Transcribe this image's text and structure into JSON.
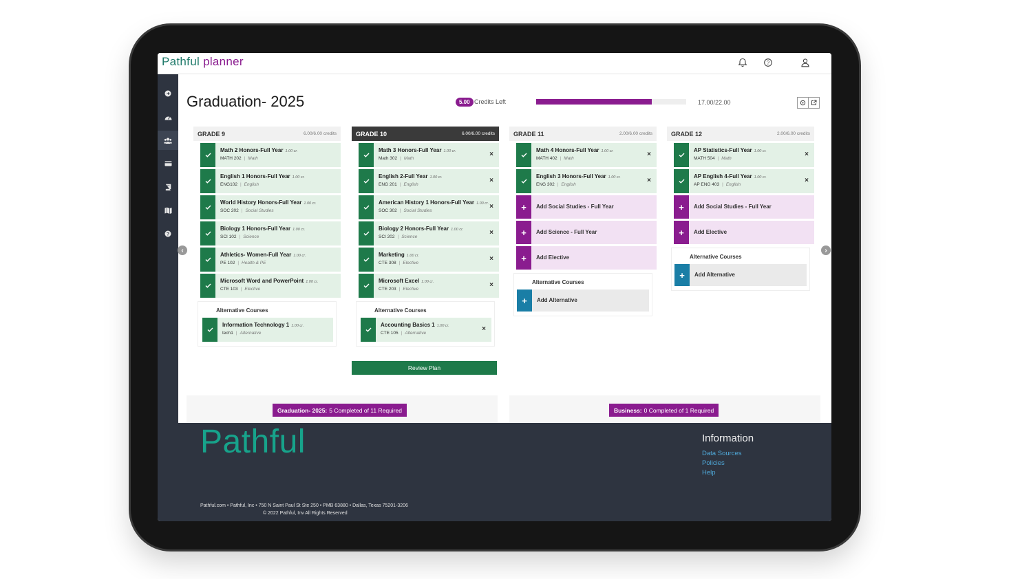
{
  "header": {
    "logo_part1": "Pathful",
    "logo_part2": "planner",
    "icons": [
      "bell-icon",
      "help-icon",
      "user-icon"
    ]
  },
  "sidebar": {
    "items": [
      "arrow-right-icon",
      "dashboard-icon",
      "users-icon",
      "card-icon",
      "book-icon",
      "map-icon",
      "help-icon"
    ],
    "active_index": 2
  },
  "plan": {
    "title": "Graduation- 2025",
    "credits_left_value": "5.00",
    "credits_left_label": "Credits Left",
    "progress_fraction": 0.7727,
    "progress_text": "17.00/22.00"
  },
  "columns": [
    {
      "grade": "GRADE 9",
      "credits": "6.00/6.00 credits",
      "courses": [
        {
          "name": "Math 2 Honors-Full Year",
          "cr": "1.00 cr.",
          "code": "MATH 202",
          "subject": "Math"
        },
        {
          "name": "English 1 Honors-Full Year",
          "cr": "1.00 cr.",
          "code": "ENG102",
          "subject": "English"
        },
        {
          "name": "World History Honors-Full Year",
          "cr": "1.00 cr.",
          "code": "SOC 202",
          "subject": "Social Studies"
        },
        {
          "name": "Biology 1 Honors-Full Year",
          "cr": "1.00 cr.",
          "code": "SCI 102",
          "subject": "Science"
        },
        {
          "name": "Athletics- Women-Full Year",
          "cr": "1.00 cr.",
          "code": "PE 102",
          "subject": "Health & PE"
        },
        {
          "name": "Microsoft Word and PowerPoint",
          "cr": "1.00 cr.",
          "code": "CTE 103",
          "subject": "Elective"
        }
      ],
      "adds": [],
      "alt_title": "Alternative Courses",
      "alt_course": {
        "name": "Information Technology 1",
        "cr": "1.00 cr.",
        "code": "tech1",
        "subject": "Alternative"
      }
    },
    {
      "grade": "GRADE 10",
      "credits": "6.00/6.00 credits",
      "courses": [
        {
          "name": "Math 3 Honors-Full Year",
          "cr": "1.00 cr.",
          "code": "Math 302",
          "subject": "Math"
        },
        {
          "name": "English 2-Full Year",
          "cr": "1.00 cr.",
          "code": "ENG 201",
          "subject": "English"
        },
        {
          "name": "American History 1 Honors-Full Year",
          "cr": "1.00 cr.",
          "code": "SOC 302",
          "subject": "Social Studies"
        },
        {
          "name": "Biology 2 Honors-Full Year",
          "cr": "1.00 cr.",
          "code": "SCI 202",
          "subject": "Science"
        },
        {
          "name": "Marketing",
          "cr": "1.00 cr.",
          "code": "CTE 308",
          "subject": "Elective"
        },
        {
          "name": "Microsoft Excel",
          "cr": "1.00 cr.",
          "code": "CTE 203",
          "subject": "Elective"
        }
      ],
      "adds": [],
      "alt_title": "Alternative Courses",
      "alt_course": {
        "name": "Accounting Basics 1",
        "cr": "1.00 cr.",
        "code": "CTE 105",
        "subject": "Alternative"
      },
      "review_label": "Review Plan"
    },
    {
      "grade": "GRADE 11",
      "credits": "2.00/6.00 credits",
      "courses": [
        {
          "name": "Math 4 Honors-Full Year",
          "cr": "1.00 cr.",
          "code": "MATH 402",
          "subject": "Math"
        },
        {
          "name": "English 3 Honors-Full Year",
          "cr": "1.00 cr.",
          "code": "ENG 302",
          "subject": "English"
        }
      ],
      "adds": [
        "Add Social Studies - Full Year",
        "Add Science - Full Year",
        "Add Elective"
      ],
      "alt_title": "Alternative Courses",
      "alt_add": "Add Alternative"
    },
    {
      "grade": "GRADE 12",
      "credits": "2.00/6.00 credits",
      "courses": [
        {
          "name": "AP Statistics-Full Year",
          "cr": "1.00 cr.",
          "code": "MATH 504",
          "subject": "Math"
        },
        {
          "name": "AP English 4-Full Year",
          "cr": "1.00 cr.",
          "code": "AP ENG 403",
          "subject": "English"
        }
      ],
      "adds": [
        "Add Social Studies - Full Year",
        "Add Elective"
      ],
      "alt_title": "Alternative Courses",
      "alt_add": "Add Alternative"
    }
  ],
  "requirements": [
    {
      "name": "Graduation- 2025:",
      "status": "5 Completed of 11 Required"
    },
    {
      "name": "Business:",
      "status": "0 Completed of 1 Required"
    }
  ],
  "footer": {
    "logo": "Pathful",
    "info_title": "Information",
    "links": [
      "Data Sources",
      "Policies",
      "Help"
    ],
    "address": "Pathful.com • Pathful, Inc • 750 N Saint Paul St Ste 250 • PMB 63880 • Dallas, Texas 75201-3206",
    "copyright": "© 2022 Pathful, Inv All Rights Reserved"
  },
  "colors": {
    "brand_green": "#1e7a4a",
    "brand_purple": "#8a1c8f",
    "alt_blue": "#1a7ea6",
    "footer_bg": "#2e3440"
  }
}
